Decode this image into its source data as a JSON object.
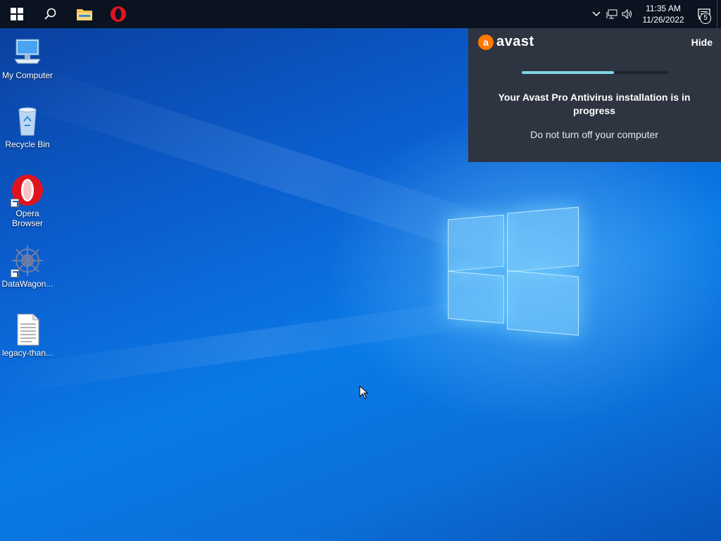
{
  "taskbar": {
    "start": "start-button",
    "search": "search-button",
    "pinned": [
      {
        "name": "file-explorer",
        "icon": "folder-icon"
      },
      {
        "name": "opera",
        "icon": "opera-icon"
      }
    ],
    "clock": {
      "time": "11:35 AM",
      "date": "11/26/2022"
    },
    "notification_count": "5"
  },
  "desktop": {
    "icons": [
      {
        "label": "My Computer",
        "icon": "computer-icon"
      },
      {
        "label": "Recycle Bin",
        "icon": "recycle-bin-icon"
      },
      {
        "label": "Opera Browser",
        "icon": "opera-icon",
        "shortcut": true
      },
      {
        "label": "DataWagon...",
        "icon": "datawagon-icon",
        "shortcut": true
      },
      {
        "label": "legacy-than...",
        "icon": "text-file-icon"
      }
    ]
  },
  "avast": {
    "brand": "avast",
    "hide_label": "Hide",
    "progress": 0.63,
    "title": "Your Avast Pro Antivirus installation is in progress",
    "subtitle": "Do not turn off your computer",
    "colors": {
      "bg": "#2e3440",
      "accent": "#ff7800",
      "progress": "#7fd3e6"
    }
  }
}
